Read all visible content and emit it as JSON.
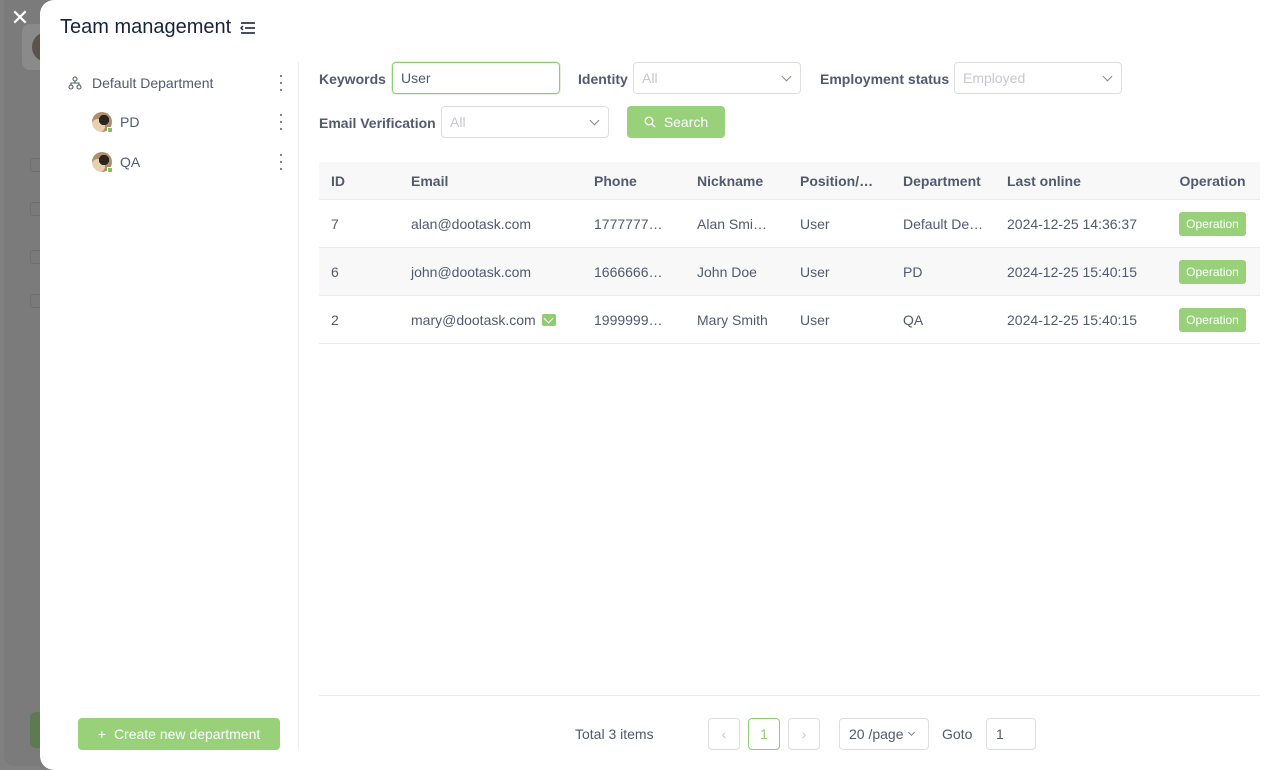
{
  "title": "Team management",
  "sidebar": {
    "departments": [
      {
        "label": "Default Department",
        "icon": "org-tree-icon"
      },
      {
        "label": "PD",
        "icon": "avatar"
      },
      {
        "label": "QA",
        "icon": "avatar"
      }
    ],
    "create_label": "Create new department"
  },
  "filters": {
    "keywords_label": "Keywords",
    "keywords_value": "User",
    "identity_label": "Identity",
    "identity_value": "All",
    "employment_label": "Employment status",
    "employment_value": "Employed",
    "email_verification_label": "Email Verification",
    "email_verification_value": "All",
    "search_label": "Search"
  },
  "table": {
    "headers": [
      "ID",
      "Email",
      "Phone",
      "Nickname",
      "Position/…",
      "Department",
      "Last online",
      "Operation"
    ],
    "rows": [
      {
        "id": "7",
        "email": "alan@dootask.com",
        "verified": false,
        "phone": "1777777…",
        "nickname": "Alan Smi…",
        "position": "User",
        "department": "Default De…",
        "last_online": "2024-12-25 14:36:37",
        "op": "Operation"
      },
      {
        "id": "6",
        "email": "john@dootask.com",
        "verified": false,
        "phone": "1666666…",
        "nickname": "John Doe",
        "position": "User",
        "department": "PD",
        "last_online": "2024-12-25 15:40:15",
        "op": "Operation"
      },
      {
        "id": "2",
        "email": "mary@dootask.com",
        "verified": true,
        "phone": "1999999…",
        "nickname": "Mary Smith",
        "position": "User",
        "department": "QA",
        "last_online": "2024-12-25 15:40:15",
        "op": "Operation"
      }
    ]
  },
  "pagination": {
    "total": "Total 3 items",
    "prev": "‹",
    "current": "1",
    "next": "›",
    "page_size": "20 /page",
    "goto_label": "Goto",
    "goto_value": "1"
  },
  "colors": {
    "accent": "#98d179",
    "accent_border": "#8fce6e"
  }
}
